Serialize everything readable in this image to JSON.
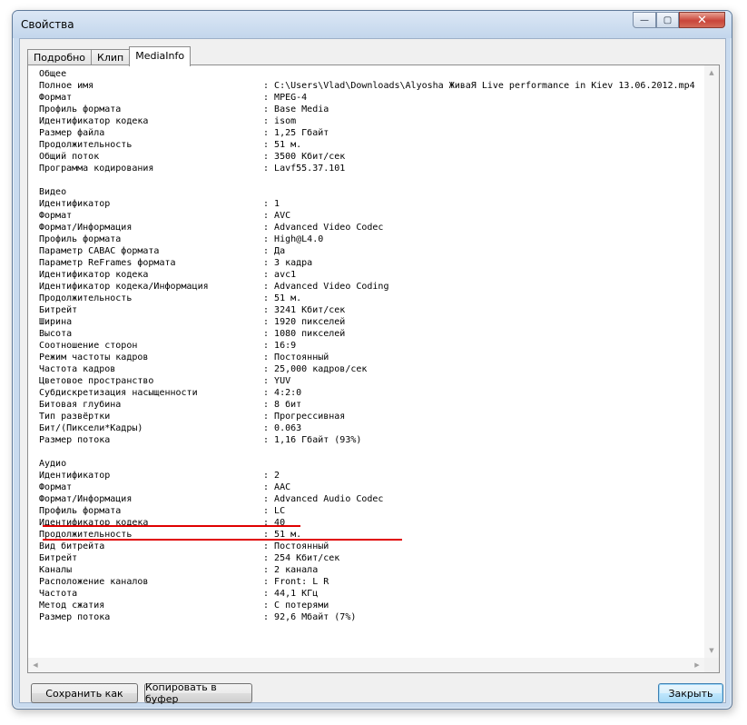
{
  "window": {
    "title": "Свойства",
    "caption": {
      "minimize": "—",
      "maximize": "▢",
      "close": "✕"
    }
  },
  "tabs": [
    {
      "label": "Подробно",
      "active": false
    },
    {
      "label": "Клип",
      "active": false
    },
    {
      "label": "MediaInfo",
      "active": true
    }
  ],
  "info": [
    {
      "section": "Общее"
    },
    {
      "key": "Полное имя",
      "value": "C:\\Users\\Vlad\\Downloads\\Alyosha ЖиваЯ Live performance in Kiev 13.06.2012.mp4"
    },
    {
      "key": "Формат",
      "value": "MPEG-4"
    },
    {
      "key": "Профиль формата",
      "value": "Base Media"
    },
    {
      "key": "Идентификатор кодека",
      "value": "isom"
    },
    {
      "key": "Размер файла",
      "value": "1,25 Гбайт"
    },
    {
      "key": "Продолжительность",
      "value": "51 м."
    },
    {
      "key": "Общий поток",
      "value": "3500 Кбит/сек"
    },
    {
      "key": "Программа кодирования",
      "value": "Lavf55.37.101"
    },
    {
      "blank": true
    },
    {
      "section": "Видео"
    },
    {
      "key": "Идентификатор",
      "value": "1"
    },
    {
      "key": "Формат",
      "value": "AVC"
    },
    {
      "key": "Формат/Информация",
      "value": "Advanced Video Codec"
    },
    {
      "key": "Профиль формата",
      "value": "High@L4.0"
    },
    {
      "key": "Параметр CABAC формата",
      "value": "Да"
    },
    {
      "key": "Параметр ReFrames формата",
      "value": "3 кадра"
    },
    {
      "key": "Идентификатор кодека",
      "value": "avc1"
    },
    {
      "key": "Идентификатор кодека/Информация",
      "value": "Advanced Video Coding"
    },
    {
      "key": "Продолжительность",
      "value": "51 м."
    },
    {
      "key": "Битрейт",
      "value": "3241 Кбит/сек"
    },
    {
      "key": "Ширина",
      "value": "1920 пикселей"
    },
    {
      "key": "Высота",
      "value": "1080 пикселей"
    },
    {
      "key": "Соотношение сторон",
      "value": "16:9"
    },
    {
      "key": "Режим частоты кадров",
      "value": "Постоянный"
    },
    {
      "key": "Частота кадров",
      "value": "25,000 кадров/сек"
    },
    {
      "key": "Цветовое пространство",
      "value": "YUV"
    },
    {
      "key": "Субдискретизация насыщенности",
      "value": "4:2:0"
    },
    {
      "key": "Битовая глубина",
      "value": "8 бит"
    },
    {
      "key": "Тип развёртки",
      "value": "Прогрессивная"
    },
    {
      "key": "Бит/(Пиксели*Кадры)",
      "value": "0.063"
    },
    {
      "key": "Размер потока",
      "value": "1,16 Гбайт (93%)"
    },
    {
      "blank": true
    },
    {
      "section": "Аудио"
    },
    {
      "key": "Идентификатор",
      "value": "2"
    },
    {
      "key": "Формат",
      "value": "AAC"
    },
    {
      "key": "Формат/Информация",
      "value": "Advanced Audio Codec"
    },
    {
      "key": "Профиль формата",
      "value": "LC"
    },
    {
      "key": "Идентификатор кодека",
      "value": "40"
    },
    {
      "key": "Продолжительность",
      "value": "51 м."
    },
    {
      "key": "Вид битрейта",
      "value": "Постоянный"
    },
    {
      "key": "Битрейт",
      "value": "254 Кбит/сек"
    },
    {
      "key": "Каналы",
      "value": "2 канала"
    },
    {
      "key": "Расположение каналов",
      "value": "Front: L R"
    },
    {
      "key": "Частота",
      "value": "44,1 КГц"
    },
    {
      "key": "Метод сжатия",
      "value": "С потерями"
    },
    {
      "key": "Размер потока",
      "value": "92,6 Мбайт (7%)"
    }
  ],
  "separator": ": ",
  "buttons": {
    "save": "Сохранить как",
    "copy": "Копировать в буфер",
    "close": "Закрыть"
  },
  "colors": {
    "highlight_underline": "#e00000"
  }
}
